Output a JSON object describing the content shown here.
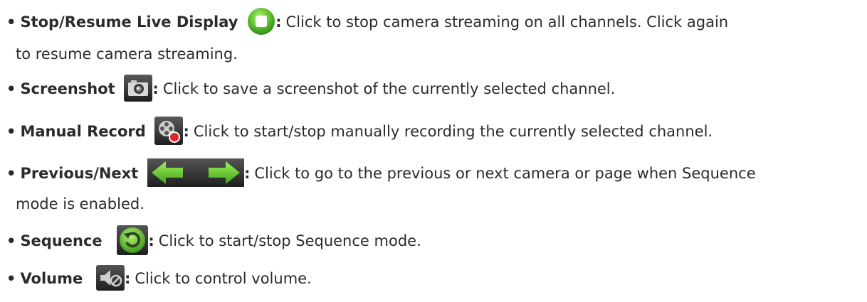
{
  "items": [
    {
      "label": "Stop/Resume Live Display",
      "icon": "stop-resume-live-icon",
      "desc_line1": "Click to stop camera streaming on all channels. Click again",
      "desc_line2": "to resume camera streaming."
    },
    {
      "label": "Screenshot",
      "icon": "camera-icon",
      "desc_line1": "Click to save a screenshot of the currently selected channel."
    },
    {
      "label": "Manual Record",
      "icon": "film-reel-record-icon",
      "desc_line1": "Click to start/stop manually recording the currently selected channel."
    },
    {
      "label": "Previous/Next",
      "icon": "green-arrows-icon",
      "desc_line1": "Click to go to the previous or next camera or page when Sequence",
      "desc_line2": "mode is enabled."
    },
    {
      "label": "Sequence",
      "icon": "sequence-cycle-icon",
      "desc_line1": "Click to start/stop Sequence mode."
    },
    {
      "label": "Volume",
      "icon": "speaker-mute-icon",
      "desc_line1": "Click to control volume."
    }
  ],
  "bullet_char": "•",
  "colon": ":"
}
